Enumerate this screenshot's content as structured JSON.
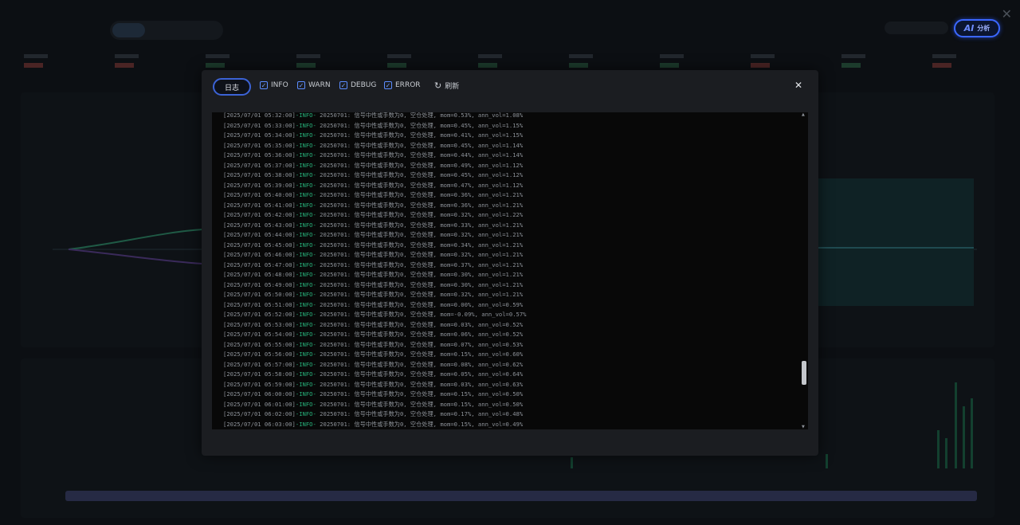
{
  "background": {
    "close_glyph": "✕",
    "ai_button": {
      "mark": "AI",
      "label": "分析"
    }
  },
  "modal": {
    "tab_label": "日志",
    "filters": [
      {
        "label": "INFO",
        "checked": true
      },
      {
        "label": "WARN",
        "checked": true
      },
      {
        "label": "DEBUG",
        "checked": true
      },
      {
        "label": "ERROR",
        "checked": true
      }
    ],
    "refresh_label": "刷新",
    "close_glyph": "✕",
    "log_lines": [
      {
        "ts": "[2025/07/01 05:32:00]",
        "level": "-INFO-",
        "msg": " 20250701: 信号中性或手数为0, 空仓处理, mom=0.53%, ann_vol=1.08%"
      },
      {
        "ts": "[2025/07/01 05:33:00]",
        "level": "-INFO-",
        "msg": " 20250701: 信号中性或手数为0, 空仓处理, mom=0.45%, ann_vol=1.15%"
      },
      {
        "ts": "[2025/07/01 05:34:00]",
        "level": "-INFO-",
        "msg": " 20250701: 信号中性或手数为0, 空仓处理, mom=0.41%, ann_vol=1.15%"
      },
      {
        "ts": "[2025/07/01 05:35:00]",
        "level": "-INFO-",
        "msg": " 20250701: 信号中性或手数为0, 空仓处理, mom=0.45%, ann_vol=1.14%"
      },
      {
        "ts": "[2025/07/01 05:36:00]",
        "level": "-INFO-",
        "msg": " 20250701: 信号中性或手数为0, 空仓处理, mom=0.44%, ann_vol=1.14%"
      },
      {
        "ts": "[2025/07/01 05:37:00]",
        "level": "-INFO-",
        "msg": " 20250701: 信号中性或手数为0, 空仓处理, mom=0.49%, ann_vol=1.12%"
      },
      {
        "ts": "[2025/07/01 05:38:00]",
        "level": "-INFO-",
        "msg": " 20250701: 信号中性或手数为0, 空仓处理, mom=0.45%, ann_vol=1.12%"
      },
      {
        "ts": "[2025/07/01 05:39:00]",
        "level": "-INFO-",
        "msg": " 20250701: 信号中性或手数为0, 空仓处理, mom=0.47%, ann_vol=1.12%"
      },
      {
        "ts": "[2025/07/01 05:40:00]",
        "level": "-INFO-",
        "msg": " 20250701: 信号中性或手数为0, 空仓处理, mom=0.36%, ann_vol=1.21%"
      },
      {
        "ts": "[2025/07/01 05:41:00]",
        "level": "-INFO-",
        "msg": " 20250701: 信号中性或手数为0, 空仓处理, mom=0.36%, ann_vol=1.21%"
      },
      {
        "ts": "[2025/07/01 05:42:00]",
        "level": "-INFO-",
        "msg": " 20250701: 信号中性或手数为0, 空仓处理, mom=0.32%, ann_vol=1.22%"
      },
      {
        "ts": "[2025/07/01 05:43:00]",
        "level": "-INFO-",
        "msg": " 20250701: 信号中性或手数为0, 空仓处理, mom=0.33%, ann_vol=1.21%"
      },
      {
        "ts": "[2025/07/01 05:44:00]",
        "level": "-INFO-",
        "msg": " 20250701: 信号中性或手数为0, 空仓处理, mom=0.32%, ann_vol=1.21%"
      },
      {
        "ts": "[2025/07/01 05:45:00]",
        "level": "-INFO-",
        "msg": " 20250701: 信号中性或手数为0, 空仓处理, mom=0.34%, ann_vol=1.21%"
      },
      {
        "ts": "[2025/07/01 05:46:00]",
        "level": "-INFO-",
        "msg": " 20250701: 信号中性或手数为0, 空仓处理, mom=0.32%, ann_vol=1.21%"
      },
      {
        "ts": "[2025/07/01 05:47:00]",
        "level": "-INFO-",
        "msg": " 20250701: 信号中性或手数为0, 空仓处理, mom=0.37%, ann_vol=1.21%"
      },
      {
        "ts": "[2025/07/01 05:48:00]",
        "level": "-INFO-",
        "msg": " 20250701: 信号中性或手数为0, 空仓处理, mom=0.30%, ann_vol=1.21%"
      },
      {
        "ts": "[2025/07/01 05:49:00]",
        "level": "-INFO-",
        "msg": " 20250701: 信号中性或手数为0, 空仓处理, mom=0.30%, ann_vol=1.21%"
      },
      {
        "ts": "[2025/07/01 05:50:00]",
        "level": "-INFO-",
        "msg": " 20250701: 信号中性或手数为0, 空仓处理, mom=0.32%, ann_vol=1.21%"
      },
      {
        "ts": "[2025/07/01 05:51:00]",
        "level": "-INFO-",
        "msg": " 20250701: 信号中性或手数为0, 空仓处理, mom=0.00%, ann_vol=0.59%"
      },
      {
        "ts": "[2025/07/01 05:52:00]",
        "level": "-INFO-",
        "msg": " 20250701: 信号中性或手数为0, 空仓处理, mom=-0.09%, ann_vol=0.57%"
      },
      {
        "ts": "[2025/07/01 05:53:00]",
        "level": "-INFO-",
        "msg": " 20250701: 信号中性或手数为0, 空仓处理, mom=0.03%, ann_vol=0.52%"
      },
      {
        "ts": "[2025/07/01 05:54:00]",
        "level": "-INFO-",
        "msg": " 20250701: 信号中性或手数为0, 空仓处理, mom=0.06%, ann_vol=0.52%"
      },
      {
        "ts": "[2025/07/01 05:55:00]",
        "level": "-INFO-",
        "msg": " 20250701: 信号中性或手数为0, 空仓处理, mom=0.07%, ann_vol=0.53%"
      },
      {
        "ts": "[2025/07/01 05:56:00]",
        "level": "-INFO-",
        "msg": " 20250701: 信号中性或手数为0, 空仓处理, mom=0.15%, ann_vol=0.60%"
      },
      {
        "ts": "[2025/07/01 05:57:00]",
        "level": "-INFO-",
        "msg": " 20250701: 信号中性或手数为0, 空仓处理, mom=0.08%, ann_vol=0.62%"
      },
      {
        "ts": "[2025/07/01 05:58:00]",
        "level": "-INFO-",
        "msg": " 20250701: 信号中性或手数为0, 空仓处理, mom=0.05%, ann_vol=0.64%"
      },
      {
        "ts": "[2025/07/01 05:59:00]",
        "level": "-INFO-",
        "msg": " 20250701: 信号中性或手数为0, 空仓处理, mom=0.03%, ann_vol=0.63%"
      },
      {
        "ts": "[2025/07/01 06:00:00]",
        "level": "-INFO-",
        "msg": " 20250701: 信号中性或手数为0, 空仓处理, mom=0.15%, ann_vol=0.50%"
      },
      {
        "ts": "[2025/07/01 06:01:00]",
        "level": "-INFO-",
        "msg": " 20250701: 信号中性或手数为0, 空仓处理, mom=0.15%, ann_vol=0.50%"
      },
      {
        "ts": "[2025/07/01 06:02:00]",
        "level": "-INFO-",
        "msg": " 20250701: 信号中性或手数为0, 空仓处理, mom=0.17%, ann_vol=0.48%"
      },
      {
        "ts": "[2025/07/01 06:03:00]",
        "level": "-INFO-",
        "msg": " 20250701: 信号中性或手数为0, 空仓处理, mom=0.15%, ann_vol=0.49%"
      }
    ]
  }
}
